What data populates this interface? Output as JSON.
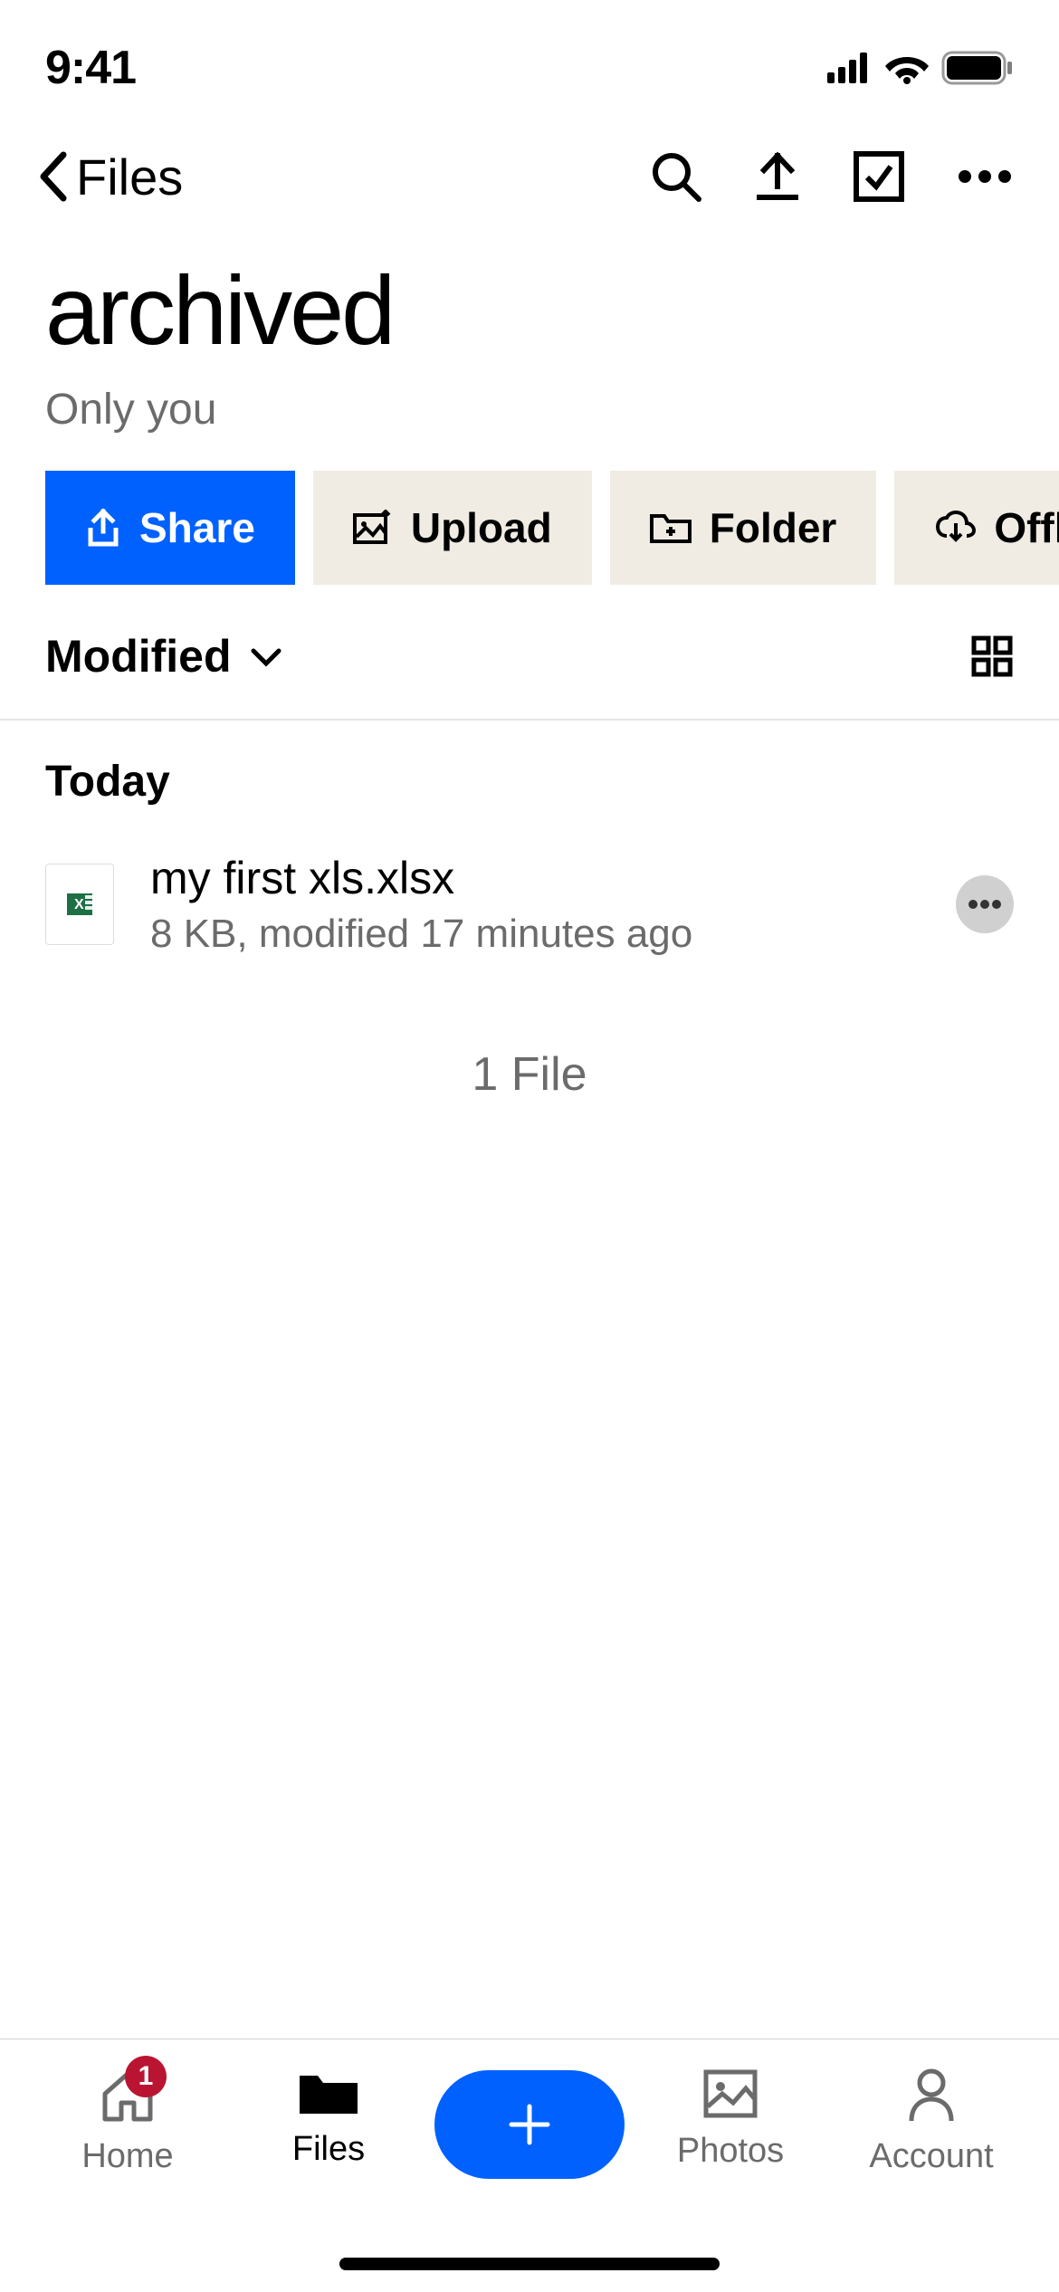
{
  "status": {
    "time": "9:41"
  },
  "nav": {
    "back_label": "Files"
  },
  "folder": {
    "title": "archived",
    "subtitle": "Only you"
  },
  "actions": {
    "share": "Share",
    "upload": "Upload",
    "folder": "Folder",
    "offline": "Offlin"
  },
  "sort": {
    "label": "Modified"
  },
  "sections": {
    "today": "Today"
  },
  "files": [
    {
      "name": "my first xls.xlsx",
      "meta": "8 KB, modified 17 minutes ago"
    }
  ],
  "summary": {
    "count": "1 File"
  },
  "tabs": {
    "home": {
      "label": "Home",
      "badge": "1"
    },
    "files": {
      "label": "Files"
    },
    "photos": {
      "label": "Photos"
    },
    "account": {
      "label": "Account"
    }
  }
}
